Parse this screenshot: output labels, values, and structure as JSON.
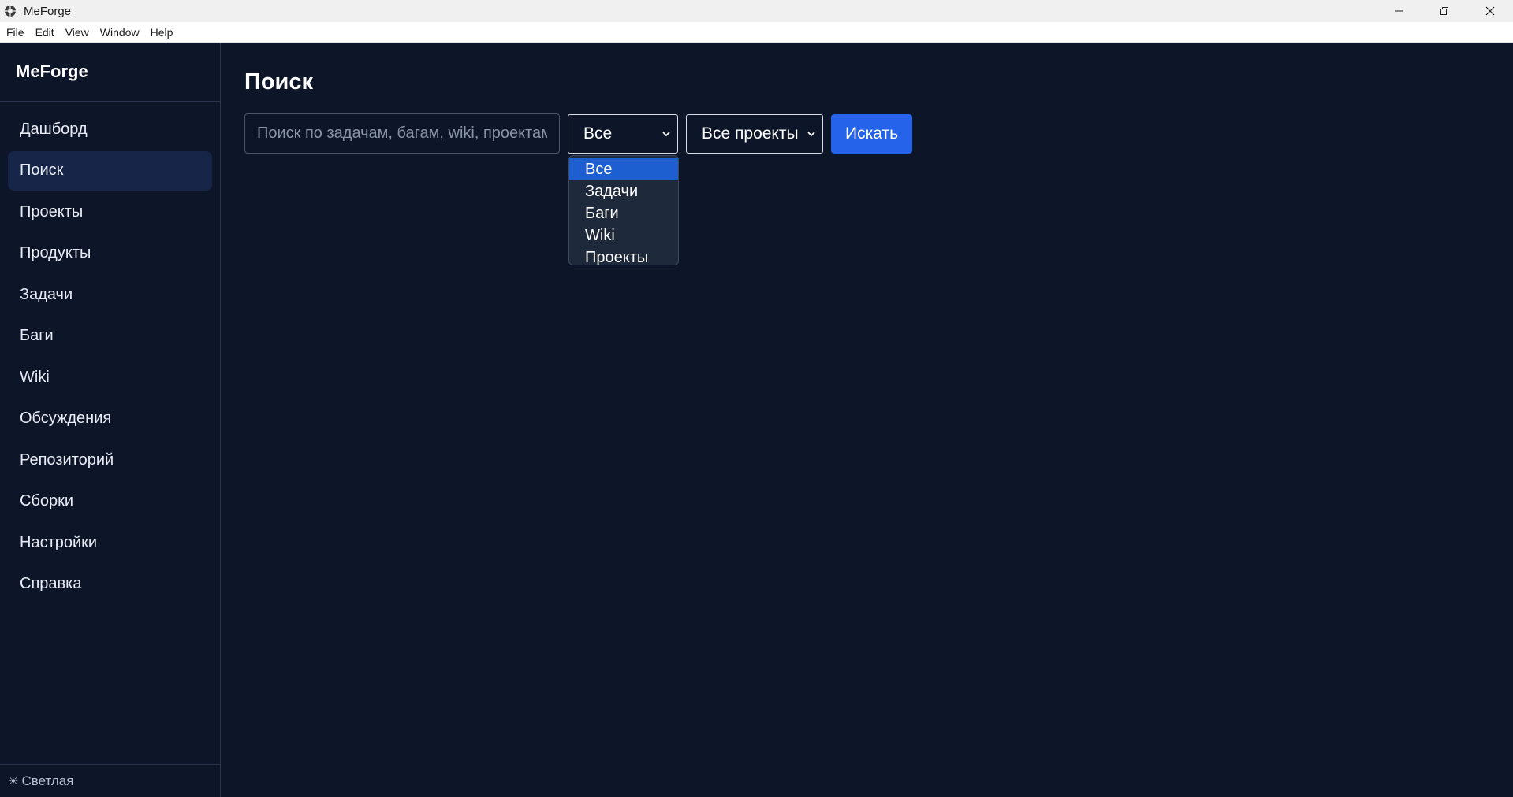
{
  "window": {
    "title": "MeForge"
  },
  "menubar": {
    "items": [
      "File",
      "Edit",
      "View",
      "Window",
      "Help"
    ]
  },
  "sidebar": {
    "brand": "MeForge",
    "items": [
      {
        "label": "Дашборд"
      },
      {
        "label": "Поиск"
      },
      {
        "label": "Проекты"
      },
      {
        "label": "Продукты"
      },
      {
        "label": "Задачи"
      },
      {
        "label": "Баги"
      },
      {
        "label": "Wiki"
      },
      {
        "label": "Обсуждения"
      },
      {
        "label": "Репозиторий"
      },
      {
        "label": "Сборки"
      },
      {
        "label": "Настройки"
      },
      {
        "label": "Справка"
      }
    ],
    "active_index": 1,
    "theme_toggle": "Светлая"
  },
  "main": {
    "title": "Поиск",
    "search": {
      "value": "",
      "placeholder": "Поиск по задачам, багам, wiki, проектам"
    },
    "type_select": {
      "value": "Все",
      "options": [
        "Все",
        "Задачи",
        "Баги",
        "Wiki",
        "Проекты"
      ],
      "selected_index": 0
    },
    "project_select": {
      "value": "Все проекты"
    },
    "search_button": "Искать"
  },
  "colors": {
    "background": "#0d1529",
    "sidebar_active": "#172548",
    "accent": "#2563eb",
    "dropdown_bg": "#1e293b",
    "dropdown_selected": "#1d5fd1"
  }
}
